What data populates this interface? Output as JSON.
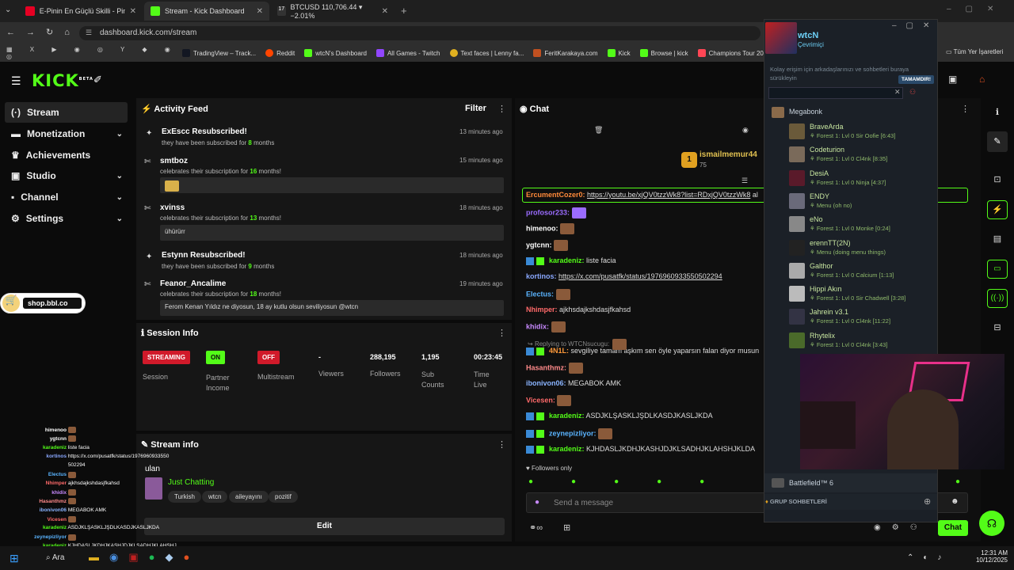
{
  "browser": {
    "tabs": [
      {
        "label": "E-Pinin En Güçlü Skilli - Pindimi",
        "color": "#e60023"
      },
      {
        "label": "Stream - Kick Dashboard",
        "color": "#53fc18"
      },
      {
        "label": "BTCUSD 110,706.44 ▾ −2.01%",
        "color": "#888888"
      }
    ],
    "url": "dashboard.kick.com/stream",
    "bookmarks": [
      "TradingView – Track...",
      "Reddit",
      "wtcN's Dashboard",
      "All Games - Twitch",
      "Text faces | Lenny fa...",
      "FeritKarakaya.com",
      "Kick",
      "Browse | kick",
      "Champions Tour 20..."
    ],
    "all_bookmarks": "Tüm Yer İşaretleri"
  },
  "brand": {
    "logo": "KICK",
    "beta": "BETA",
    "accent": "#53fc18"
  },
  "sidebar": {
    "items": [
      {
        "label": "Stream",
        "icon": "stream-icon"
      },
      {
        "label": "Monetization",
        "icon": "money-icon"
      },
      {
        "label": "Achievements",
        "icon": "trophy-icon"
      },
      {
        "label": "Studio",
        "icon": "studio-icon"
      },
      {
        "label": "Channel",
        "icon": "channel-icon"
      },
      {
        "label": "Settings",
        "icon": "gear-icon"
      }
    ],
    "shop": "shop.bbl.co"
  },
  "activity": {
    "title": "Activity Feed",
    "filter": "Filter",
    "items": [
      {
        "name": "ExEscc Resubscribed!",
        "pre": "they have been subscribed for ",
        "num": "8",
        "post": " months",
        "time": "13 minutes ago",
        "msg": ""
      },
      {
        "name": "smtboz",
        "pre": "celebrates their subscription for ",
        "num": "16",
        "post": " months!",
        "time": "15 minutes ago",
        "msg": ""
      },
      {
        "name": "xvinss",
        "pre": "celebrates their subscription for ",
        "num": "13",
        "post": " months!",
        "time": "18 minutes ago",
        "msg": "ühürürr"
      },
      {
        "name": "Estynn Resubscribed!",
        "pre": "they have been subscribed for ",
        "num": "9",
        "post": " months",
        "time": "18 minutes ago",
        "msg": ""
      },
      {
        "name": "Feanor_Ancalime",
        "pre": "celebrates their subscription for ",
        "num": "18",
        "post": " months!",
        "time": "19 minutes ago",
        "msg": "Ferom Kenan Yıldız ne diyosun, 18 ay kutlu olsun seviliyosun @wtcn"
      }
    ]
  },
  "session": {
    "title": "Session Info",
    "cols": [
      {
        "badge": "STREAMING",
        "label": "Session"
      },
      {
        "badge": "ON",
        "label": "Partner Income"
      },
      {
        "badge": "OFF",
        "label": "Multistream"
      },
      {
        "value": "-",
        "label": "Viewers"
      },
      {
        "value": "288,195",
        "label": "Followers"
      },
      {
        "value": "1,195",
        "label": "Sub Counts"
      },
      {
        "value": "00:23:45",
        "label": "Time Live"
      }
    ]
  },
  "streaminfo": {
    "title": "Stream info",
    "stream_title": "ulan",
    "category": "Just Chatting",
    "tags": [
      "Turkish",
      "wtcn",
      "aileyayını",
      "pozitif"
    ],
    "edit": "Edit"
  },
  "chat": {
    "title": "Chat",
    "pinned_user": "ismailmemur44",
    "pinned_rank": "1",
    "pinned_count": "75",
    "pinned_msg_user": "ErcumentCozer0:",
    "pinned_msg": "https://youtu.be/xjQV0tzzWk8?list=RDxjQV0tzzWk8",
    "pinned_after": "al",
    "lines": [
      {
        "user": "profosor233:",
        "color": "#9b6cff",
        "text": ""
      },
      {
        "user": "himenoo:",
        "color": "#ffffff",
        "text": ""
      },
      {
        "user": "ygtcnn:",
        "color": "#ffffff",
        "text": ""
      },
      {
        "user": "karadeniz:",
        "color": "#53fc18",
        "text": "liste facia"
      },
      {
        "user": "kortinos:",
        "color": "#8aa8ff",
        "text": "https://x.com/pusatfk/status/1976960933550502294"
      },
      {
        "user": "Electus:",
        "color": "#5ab4ff",
        "text": ""
      },
      {
        "user": "Nhimper:",
        "color": "#ff6a6a",
        "text": "ajkhsdajkshdasjfkahsd"
      },
      {
        "user": "khidix:",
        "color": "#c88aff",
        "text": ""
      },
      {
        "user": "4N1L:",
        "color": "#ff9a3a",
        "text": "sevgiliye tamam aşkım sen öyle yaparsın falan diyor musun"
      },
      {
        "user": "Hasanthmz:",
        "color": "#ff8a8a",
        "text": ""
      },
      {
        "user": "ibonivon06:",
        "color": "#8ab4ff",
        "text": "MEGABOK AMK"
      },
      {
        "user": "Vicesen:",
        "color": "#ff6a6a",
        "text": ""
      },
      {
        "user": "karadeniz:",
        "color": "#53fc18",
        "text": "ASDJKLŞASKLJŞDLKASDJKASLJKDA"
      },
      {
        "user": "zeynepizliyor:",
        "color": "#5ab4ff",
        "text": ""
      },
      {
        "user": "karadeniz:",
        "color": "#53fc18",
        "text": "KJHDASLJKDHJKASHJDJKLSADHJKLAHSHJKLDA"
      }
    ],
    "reply_to": "Replying to WTCNsucugu:",
    "followers_only": "Followers only",
    "placeholder": "Send a message",
    "chat_btn": "Chat"
  },
  "steam": {
    "user": "wtcN",
    "status": "Çevrimiçi",
    "hint": "Kolay erişim için arkadaşlarınızı ve sohbetleri buraya sürükleyin",
    "done": "TAMAMDIR!",
    "group": "Megabonk",
    "friends": [
      {
        "name": "BraveArda",
        "status": "Forest 1: Lvl 0 Sir Oofie [6:43]"
      },
      {
        "name": "Codeturion",
        "status": "Forest 1: Lvl 0 Cl4nk [8:35]"
      },
      {
        "name": "DesiA",
        "status": "Forest 1: Lvl 0 Ninja [4:37]"
      },
      {
        "name": "ENDY",
        "status": "Menu (oh no)"
      },
      {
        "name": "eNo",
        "status": "Forest 1: Lvl 0 Monke [0:24]"
      },
      {
        "name": "erennTT(2N)",
        "status": "Menu (doing menu things)"
      },
      {
        "name": "Galthor",
        "status": "Forest 1: Lvl 0 Calcium [1:13]"
      },
      {
        "name": "Hippi Akın",
        "status": "Forest 1: Lvl 0 Sir Chadwell [3:28]"
      },
      {
        "name": "Jahrein v3.1",
        "status": "Forest 1: Lvl 0 Cl4nk [11:22]"
      },
      {
        "name": "Rhytelix",
        "status": "Forest 1: Lvl 0 Cl4nk [3:43]"
      }
    ],
    "game2": "Battlefield™ 6",
    "groups": "GRUP SOHBETLERİ"
  },
  "overlay": [
    {
      "u": "himenoo",
      "t": ""
    },
    {
      "u": "ygtcnn",
      "t": ""
    },
    {
      "u": "karadeniz",
      "t": "liste facia"
    },
    {
      "u": "kortinos",
      "t": "https://x.com/pusatfk/status/1976960933550"
    },
    {
      "u": "",
      "t": "502294"
    },
    {
      "u": "Electus",
      "t": ""
    },
    {
      "u": "Nhimper",
      "t": "ajkhsdajkshdasjfkahsd"
    },
    {
      "u": "khidix",
      "t": ""
    },
    {
      "u": "Hasanthmz",
      "t": ""
    },
    {
      "u": "ibonivon06",
      "t": "MEGABOK AMK"
    },
    {
      "u": "Vicesen",
      "t": ""
    },
    {
      "u": "karadeniz",
      "t": "ASDJKLŞASKLJŞDLKASDJKASLJKDA"
    },
    {
      "u": "zeynepizliyor",
      "t": ""
    },
    {
      "u": "karadeniz",
      "t": "KJHDASLJKDHJKASHJDJKLSADHJKLAHSHJ"
    },
    {
      "u": "",
      "t": "KLDAJSHKLDA"
    }
  ],
  "taskbar": {
    "search": "Ara",
    "time": "12:31 AM",
    "date": "10/12/2025"
  }
}
